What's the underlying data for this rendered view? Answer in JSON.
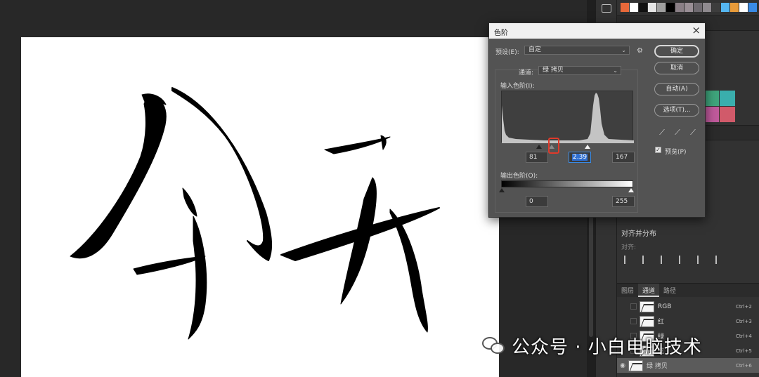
{
  "dialog": {
    "title": "色阶",
    "close_label": "×",
    "preset_label": "预设(E):",
    "preset_value": "自定",
    "channel_label": "通道:",
    "channel_value": "绿 拷贝",
    "input_levels_label": "输入色阶(I):",
    "input_black": "81",
    "input_gamma": "2.39",
    "input_white": "167",
    "input_black_fraction": 0.318,
    "input_white_fraction": 0.655,
    "output_levels_label": "输出色阶(O):",
    "output_black": "0",
    "output_white": "255",
    "buttons": {
      "ok": "确定",
      "cancel": "取消",
      "auto": "自动(A)",
      "options": "选项(T)..."
    },
    "preview_label": "预览(P)",
    "preview_checked": true
  },
  "swatches": [
    "#e8693a",
    "#ffffff",
    "#111111",
    "#e6e6e6",
    "#a0a0a0",
    "#000000",
    "#8a7f86",
    "#9a8f96",
    "#6f6a70",
    "#8f8a8f",
    "#3d3d3d",
    "#55b6f0",
    "#e89b3a",
    "#ffffff",
    "#3a8be6"
  ],
  "color_grid": [
    "#6fbf62",
    "#3fa57c",
    "#3aaead",
    "#9b5fb0",
    "#c05a9c",
    "#d15a6a"
  ],
  "align_panel": {
    "title": "对齐并分布",
    "subtitle": "对齐:"
  },
  "panel_tabs": [
    "图层",
    "通道",
    "路径"
  ],
  "active_tab": "通道",
  "channels": [
    {
      "name": "RGB",
      "shortcut": "Ctrl+2",
      "visible": false
    },
    {
      "name": "红",
      "shortcut": "Ctrl+3",
      "visible": false
    },
    {
      "name": "绿",
      "shortcut": "Ctrl+4",
      "visible": false
    },
    {
      "name": "蓝",
      "shortcut": "Ctrl+5",
      "visible": false
    },
    {
      "name": "绿 拷贝",
      "shortcut": "Ctrl+6",
      "visible": true
    }
  ],
  "watermark": "公众号 · 小白电脑技术"
}
